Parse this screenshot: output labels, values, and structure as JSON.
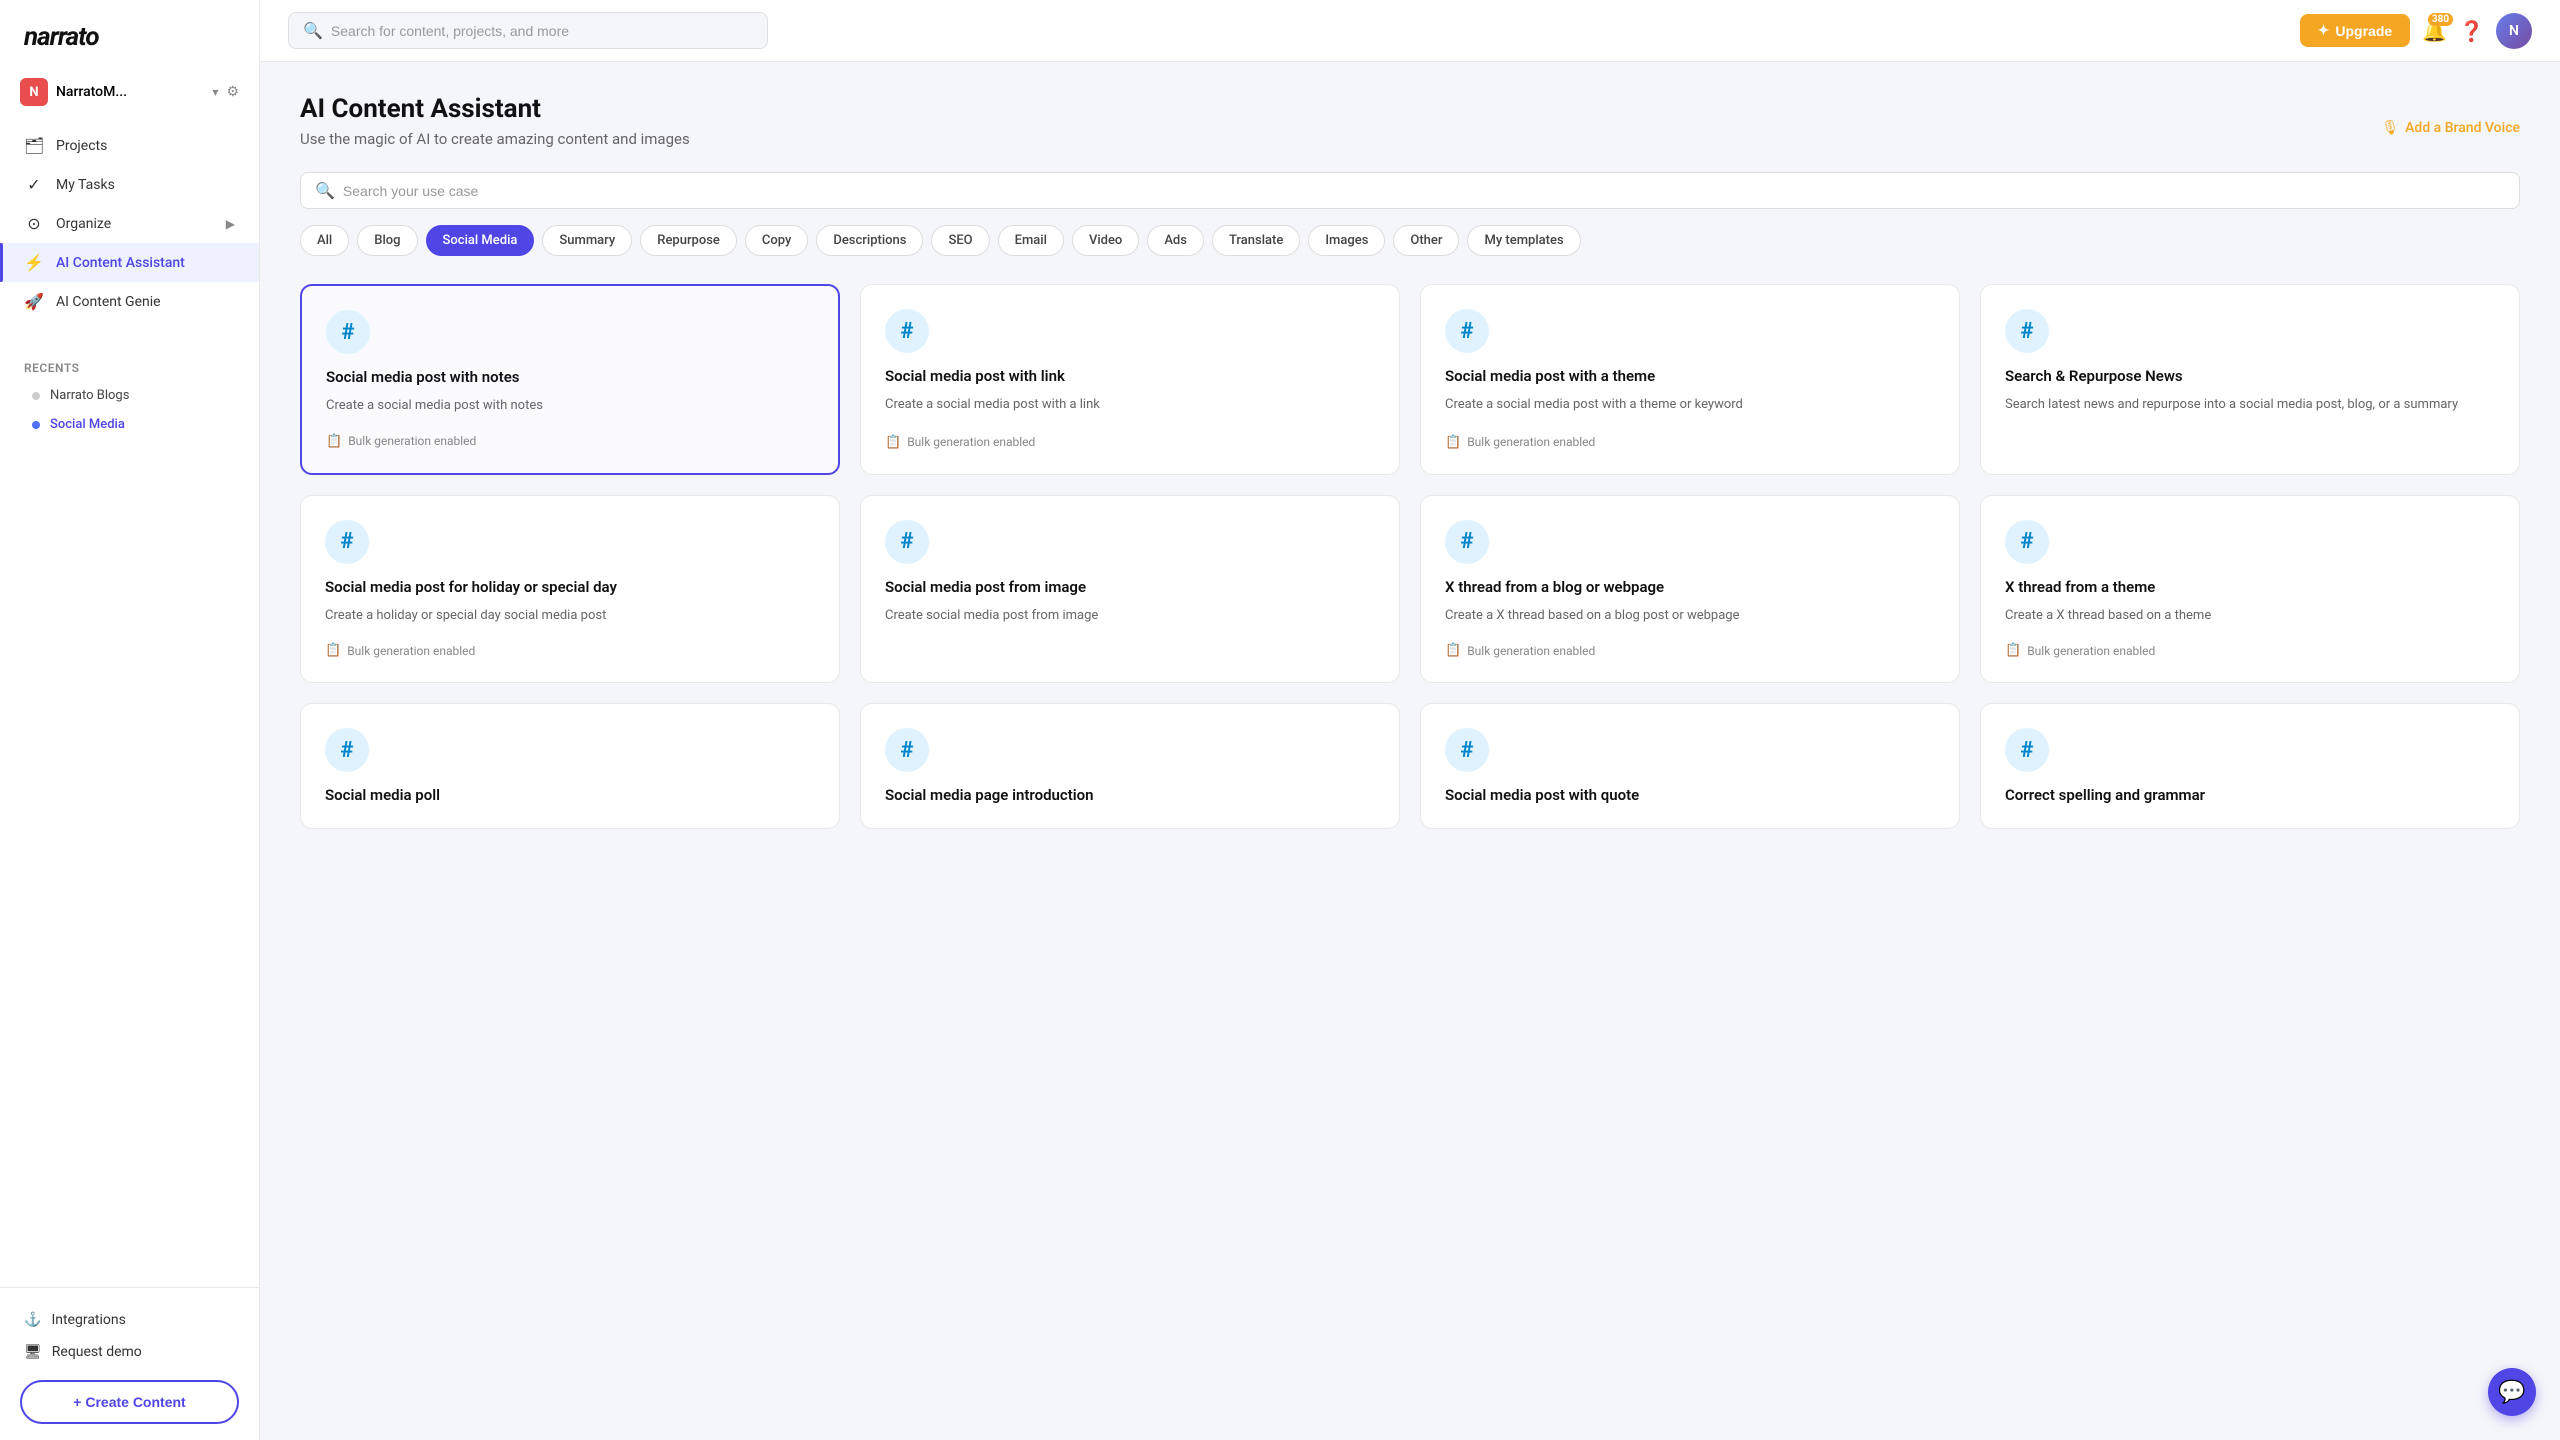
{
  "logo": "narrato",
  "workspace": {
    "initial": "N",
    "name": "NarratoM..."
  },
  "sidebar": {
    "nav_items": [
      {
        "id": "projects",
        "label": "Projects",
        "icon": "🗂"
      },
      {
        "id": "my-tasks",
        "label": "My Tasks",
        "icon": "✓"
      },
      {
        "id": "organize",
        "label": "Organize",
        "icon": "⊙",
        "has_arrow": true
      },
      {
        "id": "ai-content-assistant",
        "label": "AI Content Assistant",
        "icon": "⚡",
        "active": true
      },
      {
        "id": "ai-content-genie",
        "label": "AI Content Genie",
        "icon": "🚀"
      }
    ],
    "recents_label": "Recents",
    "recents": [
      {
        "id": "narrato-blogs",
        "label": "Narrato Blogs",
        "active": false
      },
      {
        "id": "social-media",
        "label": "Social Media",
        "active": true
      }
    ],
    "bottom_items": [
      {
        "id": "integrations",
        "label": "Integrations",
        "icon": "⚓"
      },
      {
        "id": "request-demo",
        "label": "Request demo",
        "icon": "🖥"
      }
    ],
    "create_btn_label": "+ Create Content"
  },
  "topbar": {
    "search_placeholder": "Search for content, projects, and more",
    "upgrade_label": "Upgrade",
    "notification_count": "380"
  },
  "header": {
    "title": "AI Content Assistant",
    "subtitle": "Use the magic of AI to create amazing content and images",
    "add_brand_voice": "Add a Brand Voice"
  },
  "filter_search_placeholder": "Search your use case",
  "filters": [
    {
      "id": "all",
      "label": "All",
      "active": false
    },
    {
      "id": "blog",
      "label": "Blog",
      "active": false
    },
    {
      "id": "social-media",
      "label": "Social Media",
      "active": true
    },
    {
      "id": "summary",
      "label": "Summary",
      "active": false
    },
    {
      "id": "repurpose",
      "label": "Repurpose",
      "active": false
    },
    {
      "id": "copy",
      "label": "Copy",
      "active": false
    },
    {
      "id": "descriptions",
      "label": "Descriptions",
      "active": false
    },
    {
      "id": "seo",
      "label": "SEO",
      "active": false
    },
    {
      "id": "email",
      "label": "Email",
      "active": false
    },
    {
      "id": "video",
      "label": "Video",
      "active": false
    },
    {
      "id": "ads",
      "label": "Ads",
      "active": false
    },
    {
      "id": "translate",
      "label": "Translate",
      "active": false
    },
    {
      "id": "images",
      "label": "Images",
      "active": false
    },
    {
      "id": "other",
      "label": "Other",
      "active": false
    },
    {
      "id": "my-templates",
      "label": "My templates",
      "active": false
    }
  ],
  "cards": [
    {
      "id": "social-notes",
      "title": "Social media post with notes",
      "desc": "Create a social media post with notes",
      "bulk": "Bulk generation enabled",
      "selected": true
    },
    {
      "id": "social-link",
      "title": "Social media post with link",
      "desc": "Create a social media post with a link",
      "bulk": "Bulk generation enabled",
      "selected": false
    },
    {
      "id": "social-theme",
      "title": "Social media post with a theme",
      "desc": "Create a social media post with a theme or keyword",
      "bulk": "Bulk generation enabled",
      "selected": false
    },
    {
      "id": "search-repurpose-news",
      "title": "Search & Repurpose News",
      "desc": "Search latest news and repurpose into a social media post, blog, or a summary",
      "bulk": null,
      "selected": false
    },
    {
      "id": "social-holiday",
      "title": "Social media post for holiday or special day",
      "desc": "Create a holiday or special day social media post",
      "bulk": "Bulk generation enabled",
      "selected": false
    },
    {
      "id": "social-from-image",
      "title": "Social media post from image",
      "desc": "Create social media post from image",
      "bulk": null,
      "selected": false
    },
    {
      "id": "x-thread-blog",
      "title": "X thread from a blog or webpage",
      "desc": "Create a X thread based on a blog post or webpage",
      "bulk": "Bulk generation enabled",
      "selected": false
    },
    {
      "id": "x-thread-theme",
      "title": "X thread from a theme",
      "desc": "Create a X thread based on a theme",
      "bulk": "Bulk generation enabled",
      "selected": false
    },
    {
      "id": "social-poll",
      "title": "Social media poll",
      "desc": "",
      "bulk": null,
      "selected": false
    },
    {
      "id": "social-page-intro",
      "title": "Social media page introduction",
      "desc": "",
      "bulk": null,
      "selected": false
    },
    {
      "id": "social-quote",
      "title": "Social media post with quote",
      "desc": "",
      "bulk": null,
      "selected": false
    },
    {
      "id": "correct-spelling",
      "title": "Correct spelling and grammar",
      "desc": "",
      "bulk": null,
      "selected": false
    }
  ]
}
